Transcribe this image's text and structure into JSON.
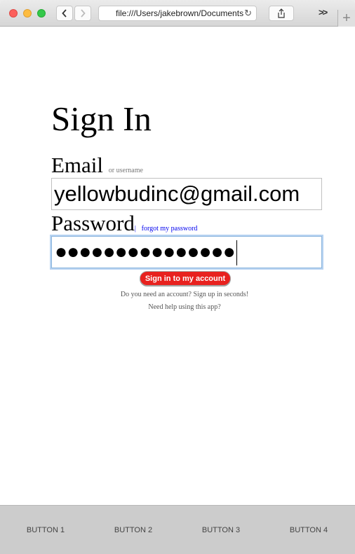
{
  "browser": {
    "url": "file:///Users/jakebrown/Documents",
    "overflow_label": ">>",
    "new_tab_label": "+"
  },
  "page": {
    "title": "Sign In",
    "email_label": "Email",
    "email_hint": "or username",
    "email_value": "yellowbudinc@gmail.com",
    "password_label": "Password",
    "forgot_separator": "|",
    "forgot_link": "forgot my password",
    "password_value": "●●●●●●●●●●●●●●●",
    "signin_button": "Sign in to my account",
    "signup_text": "Do you need an account? Sign up in seconds!",
    "help_text": "Need help using this app?"
  },
  "footer": {
    "buttons": [
      "BUTTON 1",
      "BUTTON 2",
      "BUTTON 3",
      "BUTTON 4"
    ]
  },
  "colors": {
    "signin_button": "#e8211e",
    "link": "#0000ee",
    "footer_bg": "#cccccc"
  },
  "icons": [
    "back-chevron-icon",
    "forward-chevron-icon",
    "reload-icon",
    "share-icon"
  ]
}
